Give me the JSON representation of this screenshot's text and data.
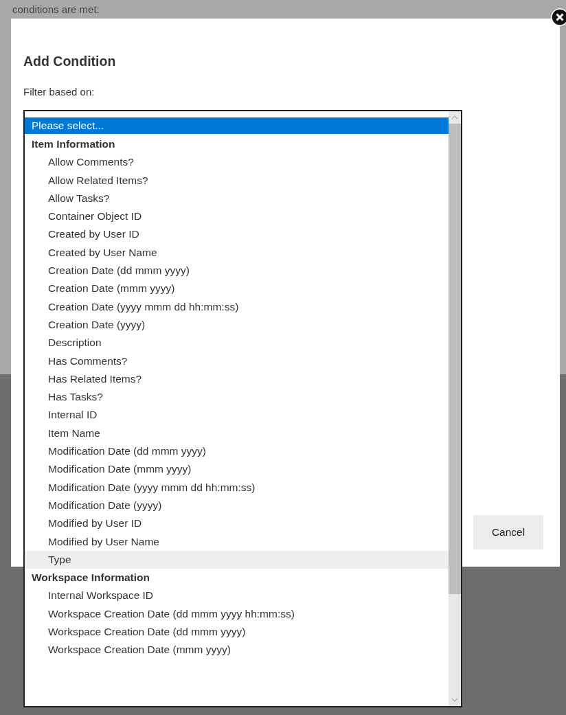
{
  "background": {
    "text": "conditions are met:"
  },
  "dialog": {
    "title": "Add Condition",
    "label": "Filter based on:",
    "buttons": [
      "Cancel"
    ]
  },
  "listbox": {
    "options": [
      {
        "kind": "option",
        "label": "Please select...",
        "selected": true,
        "hovered": false
      },
      {
        "kind": "header",
        "label": "Item Information"
      },
      {
        "kind": "option",
        "label": "Allow Comments?",
        "selected": false,
        "hovered": false
      },
      {
        "kind": "option",
        "label": "Allow Related Items?",
        "selected": false,
        "hovered": false
      },
      {
        "kind": "option",
        "label": "Allow Tasks?",
        "selected": false,
        "hovered": false
      },
      {
        "kind": "option",
        "label": "Container Object ID",
        "selected": false,
        "hovered": false
      },
      {
        "kind": "option",
        "label": "Created by User ID",
        "selected": false,
        "hovered": false
      },
      {
        "kind": "option",
        "label": "Created by User Name",
        "selected": false,
        "hovered": false
      },
      {
        "kind": "option",
        "label": "Creation Date (dd mmm yyyy)",
        "selected": false,
        "hovered": false
      },
      {
        "kind": "option",
        "label": "Creation Date (mmm yyyy)",
        "selected": false,
        "hovered": false
      },
      {
        "kind": "option",
        "label": "Creation Date (yyyy mmm dd hh:mm:ss)",
        "selected": false,
        "hovered": false
      },
      {
        "kind": "option",
        "label": "Creation Date (yyyy)",
        "selected": false,
        "hovered": false
      },
      {
        "kind": "option",
        "label": "Description",
        "selected": false,
        "hovered": false
      },
      {
        "kind": "option",
        "label": "Has Comments?",
        "selected": false,
        "hovered": false
      },
      {
        "kind": "option",
        "label": "Has Related Items?",
        "selected": false,
        "hovered": false
      },
      {
        "kind": "option",
        "label": "Has Tasks?",
        "selected": false,
        "hovered": false
      },
      {
        "kind": "option",
        "label": "Internal ID",
        "selected": false,
        "hovered": false
      },
      {
        "kind": "option",
        "label": "Item Name",
        "selected": false,
        "hovered": false
      },
      {
        "kind": "option",
        "label": "Modification Date (dd mmm yyyy)",
        "selected": false,
        "hovered": false
      },
      {
        "kind": "option",
        "label": "Modification Date (mmm yyyy)",
        "selected": false,
        "hovered": false
      },
      {
        "kind": "option",
        "label": "Modification Date (yyyy mmm dd hh:mm:ss)",
        "selected": false,
        "hovered": false
      },
      {
        "kind": "option",
        "label": "Modification Date (yyyy)",
        "selected": false,
        "hovered": false
      },
      {
        "kind": "option",
        "label": "Modified by User ID",
        "selected": false,
        "hovered": false
      },
      {
        "kind": "option",
        "label": "Modified by User Name",
        "selected": false,
        "hovered": false
      },
      {
        "kind": "option",
        "label": "Type",
        "selected": false,
        "hovered": true
      },
      {
        "kind": "header",
        "label": "Workspace Information"
      },
      {
        "kind": "option",
        "label": "Internal Workspace ID",
        "selected": false,
        "hovered": false
      },
      {
        "kind": "option",
        "label": "Workspace Creation Date (dd mmm yyyy hh:mm:ss)",
        "selected": false,
        "hovered": false
      },
      {
        "kind": "option",
        "label": "Workspace Creation Date (dd mmm yyyy)",
        "selected": false,
        "hovered": false
      },
      {
        "kind": "option",
        "label": "Workspace Creation Date (mmm yyyy)",
        "selected": false,
        "hovered": false
      }
    ]
  }
}
